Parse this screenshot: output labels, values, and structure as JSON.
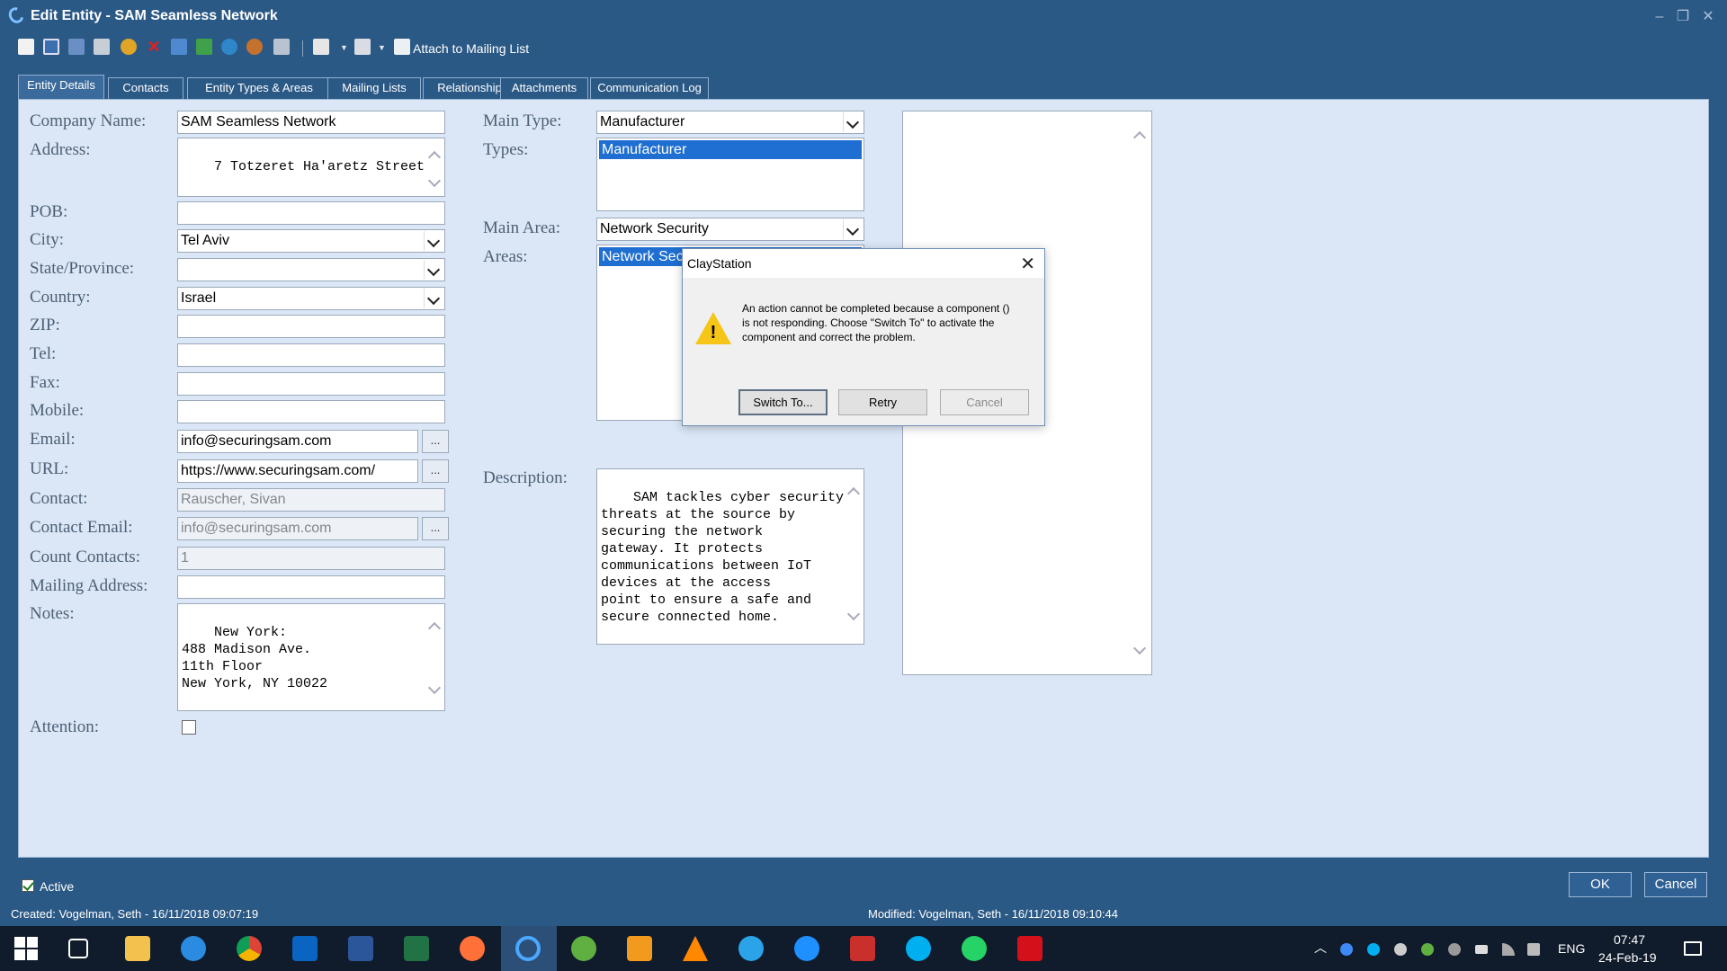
{
  "window": {
    "title": "Edit Entity - SAM Seamless Network",
    "minimize": "–",
    "restore": "❐",
    "close": "✕"
  },
  "toolbar": {
    "attach_label": "Attach to Mailing List",
    "icons": [
      "new-icon",
      "save-icon",
      "save-close-icon",
      "print-icon",
      "refresh-icon",
      "delete-icon",
      "copy-icon",
      "export-icon",
      "sync-icon",
      "users-icon",
      "print-preview-icon",
      "edit-icon",
      "document-icon",
      "attach-icon"
    ]
  },
  "tabs": [
    "Entity Details",
    "Contacts",
    "Entity Types & Areas",
    "Mailing Lists",
    "Relationship",
    "Attachments",
    "Communication Log"
  ],
  "form": {
    "company_name_label": "Company Name:",
    "company_name": "SAM Seamless Network",
    "address_label": "Address:",
    "address": "7 Totzeret Ha'aretz Street",
    "pob_label": "POB:",
    "pob": "",
    "city_label": "City:",
    "city": "Tel Aviv",
    "state_label": "State/Province:",
    "state": "",
    "country_label": "Country:",
    "country": "Israel",
    "zip_label": "ZIP:",
    "zip": "",
    "tel_label": "Tel:",
    "tel": "",
    "fax_label": "Fax:",
    "fax": "",
    "mobile_label": "Mobile:",
    "mobile": "",
    "email_label": "Email:",
    "email": "info@securingsam.com",
    "url_label": "URL:",
    "url": "https://www.securingsam.com/",
    "contact_label": "Contact:",
    "contact": "Rauscher, Sivan",
    "contact_email_label": "Contact Email:",
    "contact_email": "info@securingsam.com",
    "count_contacts_label": "Count Contacts:",
    "count_contacts": "1",
    "mailing_address_label": "Mailing Address:",
    "mailing_address": "",
    "notes_label": "Notes:",
    "notes": "New York:\n488 Madison Ave.\n11th Floor\nNew York, NY 10022",
    "attention_label": "Attention:",
    "dots": "...",
    "main_type_label": "Main Type:",
    "main_type": "Manufacturer",
    "types_label": "Types:",
    "types_selected": "Manufacturer",
    "main_area_label": "Main Area:",
    "main_area": "Network Security",
    "areas_label": "Areas:",
    "areas_selected": "Network Security",
    "description_label": "Description:",
    "description": "SAM tackles cyber security\nthreats at the source by\nsecuring the network\ngateway. It protects\ncommunications between IoT\ndevices at the access\npoint to ensure a safe and\nsecure connected home."
  },
  "dialog": {
    "title": "ClayStation",
    "close": "✕",
    "mark": "!",
    "message": "An action cannot be completed because a component () is not responding.  Choose \"Switch To\" to activate the component and correct the problem.",
    "switch_to": "Switch To...",
    "retry": "Retry",
    "cancel": "Cancel"
  },
  "footer": {
    "active_label": "Active",
    "ok": "OK",
    "cancel": "Cancel",
    "created": "Created: Vogelman, Seth - 16/11/2018 09:07:19",
    "modified": "Modified: Vogelman, Seth - 16/11/2018 09:10:44"
  },
  "taskbar": {
    "language": "ENG",
    "time": "07:47",
    "date": "24-Feb-19",
    "apps": [
      "start-icon",
      "task-view-icon",
      "file-explorer-icon",
      "internet-explorer-icon",
      "chrome-icon",
      "outlook-icon",
      "word-icon",
      "excel-icon",
      "firefox-icon",
      "claystation-icon",
      "utorrent-icon",
      "media-player-icon",
      "vlc-icon",
      "grammarly-icon",
      "messenger-icon",
      "shield-app-icon",
      "skype-icon",
      "whatsapp-icon",
      "acrobat-icon"
    ]
  },
  "colors": {
    "window_bg": "#2b5986",
    "panel_bg": "#dbe7f6",
    "selection": "#1e6fd1",
    "taskbar": "#101c2b"
  }
}
